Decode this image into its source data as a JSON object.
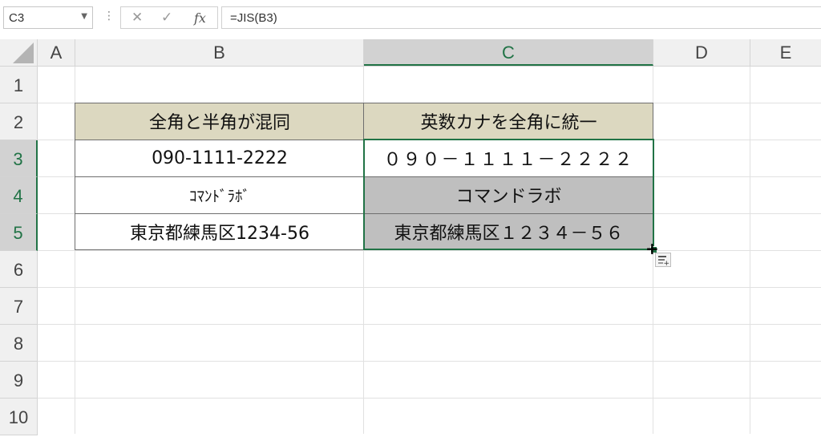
{
  "formula_bar": {
    "name_box": "C3",
    "formula": "=JIS(B3)",
    "cancel_icon": "✕",
    "enter_icon": "✓",
    "fx_label": "fx"
  },
  "columns": [
    "A",
    "B",
    "C",
    "D",
    "E"
  ],
  "selected_column": "C",
  "rows": [
    "1",
    "2",
    "3",
    "4",
    "5",
    "6",
    "7",
    "8",
    "9",
    "10"
  ],
  "selected_rows": [
    "3",
    "4",
    "5"
  ],
  "table": {
    "header_b": "全角と半角が混同",
    "header_c": "英数カナを全角に統一",
    "rows": [
      {
        "b": "090-1111-2222",
        "c": "０９０－１１１１－２２２２"
      },
      {
        "b": "ｺﾏﾝﾄﾞﾗﾎﾞ",
        "c": "コマンドラボ"
      },
      {
        "b": "東京都練馬区1234-56",
        "c": "東京都練馬区１２３４－５６"
      }
    ]
  },
  "colors": {
    "accent": "#217346",
    "header_fill": "#dcd8c0",
    "gray_fill": "#bfbfbf"
  }
}
